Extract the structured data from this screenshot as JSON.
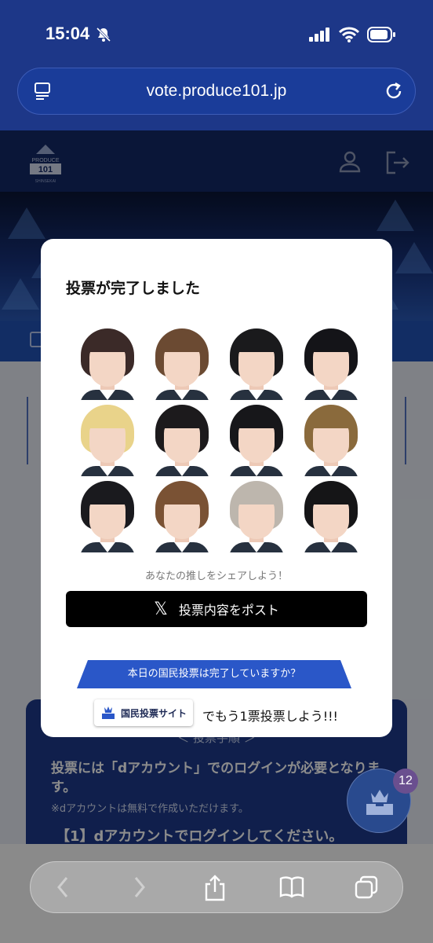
{
  "status": {
    "time": "15:04"
  },
  "browser": {
    "url": "vote.produce101.jp"
  },
  "site": {
    "logo_label": "PRODUCE 101"
  },
  "modal": {
    "title": "投票が完了しました",
    "share_label": "あなたの推しをシェアしよう！",
    "post_button": "投票内容をポスト",
    "promo_ribbon": "本日の国民投票は完了していますか？",
    "promo_site_label": "国民投票サイト",
    "promo_text": "でもう1票投票しよう!!!"
  },
  "trainees": [
    {
      "hair": "#3b2a28"
    },
    {
      "hair": "#6b4a32"
    },
    {
      "hair": "#1a1a1c"
    },
    {
      "hair": "#141418"
    },
    {
      "hair": "#e9d38a"
    },
    {
      "hair": "#1c1a1c"
    },
    {
      "hair": "#17171a"
    },
    {
      "hair": "#8a6a3c"
    },
    {
      "hair": "#1a1a1e"
    },
    {
      "hair": "#7a5234"
    },
    {
      "hair": "#bdb6ad"
    },
    {
      "hair": "#151517"
    }
  ],
  "background": {
    "guide_title": "＜ 投票手順 ＞",
    "guide_text": "投票には「dアカウント」でのログインが必要となります。",
    "guide_note": "※dアカウントは無料で作成いただけます。",
    "guide_step": "【1】dアカウントでログインしてください。"
  },
  "fab": {
    "badge": "12"
  }
}
